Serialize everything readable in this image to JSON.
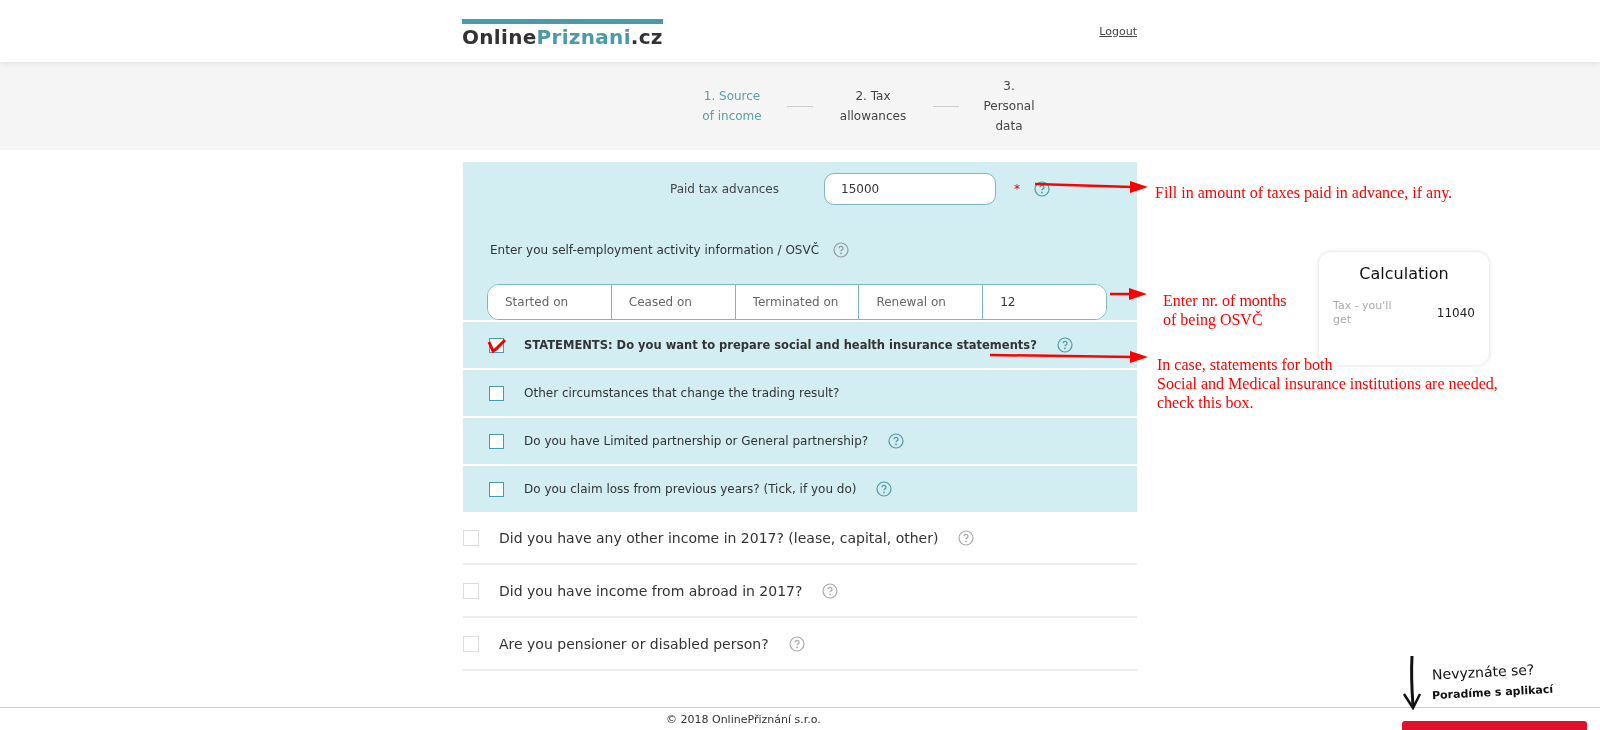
{
  "header": {
    "logo": {
      "part_1": "Online",
      "part_2": "Priznani",
      "part_3": ".cz"
    },
    "logout": "Logout"
  },
  "steps": [
    {
      "label": "1. Source of income",
      "selected": true
    },
    {
      "label": "2. Tax allowances",
      "selected": false
    },
    {
      "label": "3. Personal data",
      "selected": false
    }
  ],
  "form": {
    "paid_tax": {
      "label": "Paid tax advances",
      "value": "15000",
      "required_mark": "*"
    },
    "osvc": {
      "label": "Enter you self-employment activity information / OSVČ",
      "fields": [
        {
          "placeholder": "Started on"
        },
        {
          "placeholder": "Ceased on"
        },
        {
          "placeholder": "Terminated on"
        },
        {
          "placeholder": "Renewal on"
        },
        {
          "value": "12"
        }
      ]
    },
    "panel_questions": [
      {
        "label": "STATEMENTS: Do you want to prepare social and health insurance statements?",
        "checked": true,
        "bold": true,
        "help": true
      },
      {
        "label": "Other circumstances that change the trading result?",
        "checked": false,
        "bold": false,
        "help": false
      },
      {
        "label": "Do you have Limited partnership or General partnership?",
        "checked": false,
        "bold": false,
        "help": true
      },
      {
        "label": "Do you claim loss from previous years? (Tick, if you do)",
        "checked": false,
        "bold": false,
        "help": true
      }
    ],
    "other_questions": [
      {
        "label": "Did you have any other income in 2017? (lease, capital, other)",
        "checked": false,
        "help": true
      },
      {
        "label": "Did you have income from abroad in 2017?",
        "checked": false,
        "help": true
      },
      {
        "label": "Are you pensioner or disabled person?",
        "checked": false,
        "help": true
      }
    ]
  },
  "calculation": {
    "title": "Calculation",
    "label": "Tax - you'll get",
    "value": "11040"
  },
  "annotations": [
    {
      "text": "Fill in amount of taxes paid in advance, if any."
    },
    {
      "text": "Enter nr. of months\nof being OSVČ"
    },
    {
      "text": "In case, statements for both\nSocial and Medical insurance institutions are needed,\ncheck this box."
    }
  ],
  "help_hint": {
    "line_1": "Nevyznáte se?",
    "line_2": "Poradíme s aplikací"
  },
  "footer": {
    "copyright": "© 2018 OnlinePřiznání s.r.o."
  }
}
